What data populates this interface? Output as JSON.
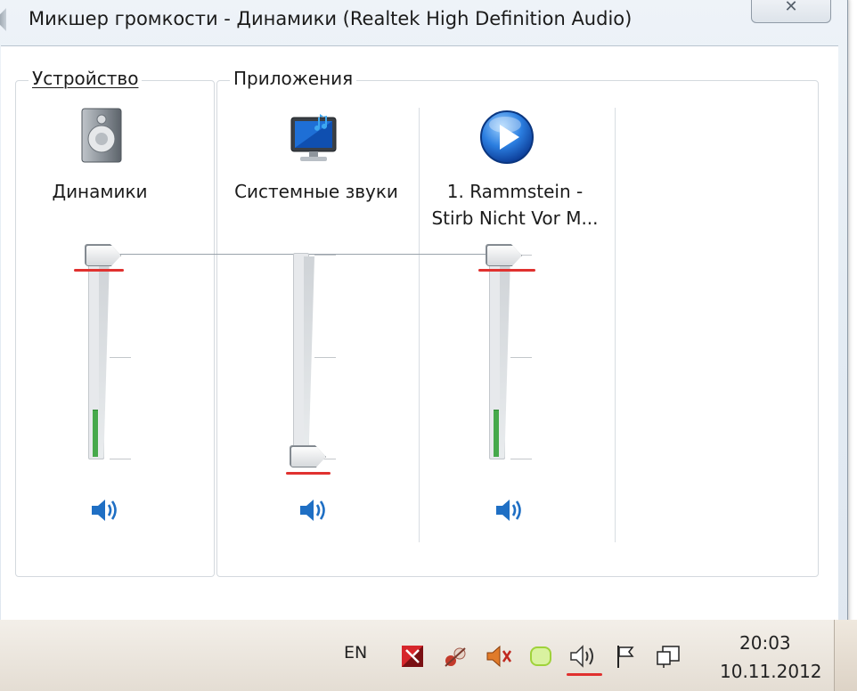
{
  "window": {
    "title": "Микшер громкости - Динамики (Realtek High Definition Audio)",
    "close_glyph": "✕"
  },
  "device_group": {
    "label": "Устройство",
    "channel": {
      "name": "Динамики",
      "icon": "speaker-device-icon",
      "volume": 1.0,
      "level": 0.25
    }
  },
  "apps_group": {
    "label": "Приложения",
    "channels": [
      {
        "name": "Системные звуки",
        "icon": "system-sounds-monitor-icon",
        "volume": 0.0,
        "level": 0.0
      },
      {
        "name_line1": "1. Rammstein -",
        "name_line2": "Stirb Nicht Vor M...",
        "icon": "media-player-icon",
        "volume": 1.0,
        "level": 0.25
      }
    ]
  },
  "taskbar": {
    "language": "EN",
    "time": "20:03",
    "date": "10.11.2012",
    "tray_icons": [
      "antivirus-icon",
      "network-tool-icon",
      "speaker-muted-icon",
      "green-app-icon",
      "volume-icon",
      "action-center-flag-icon",
      "network-icon"
    ]
  },
  "colors": {
    "meter_green": "#46a94b",
    "annotation_red": "#e0312f",
    "speaker_blue": "#1f6fc4"
  }
}
